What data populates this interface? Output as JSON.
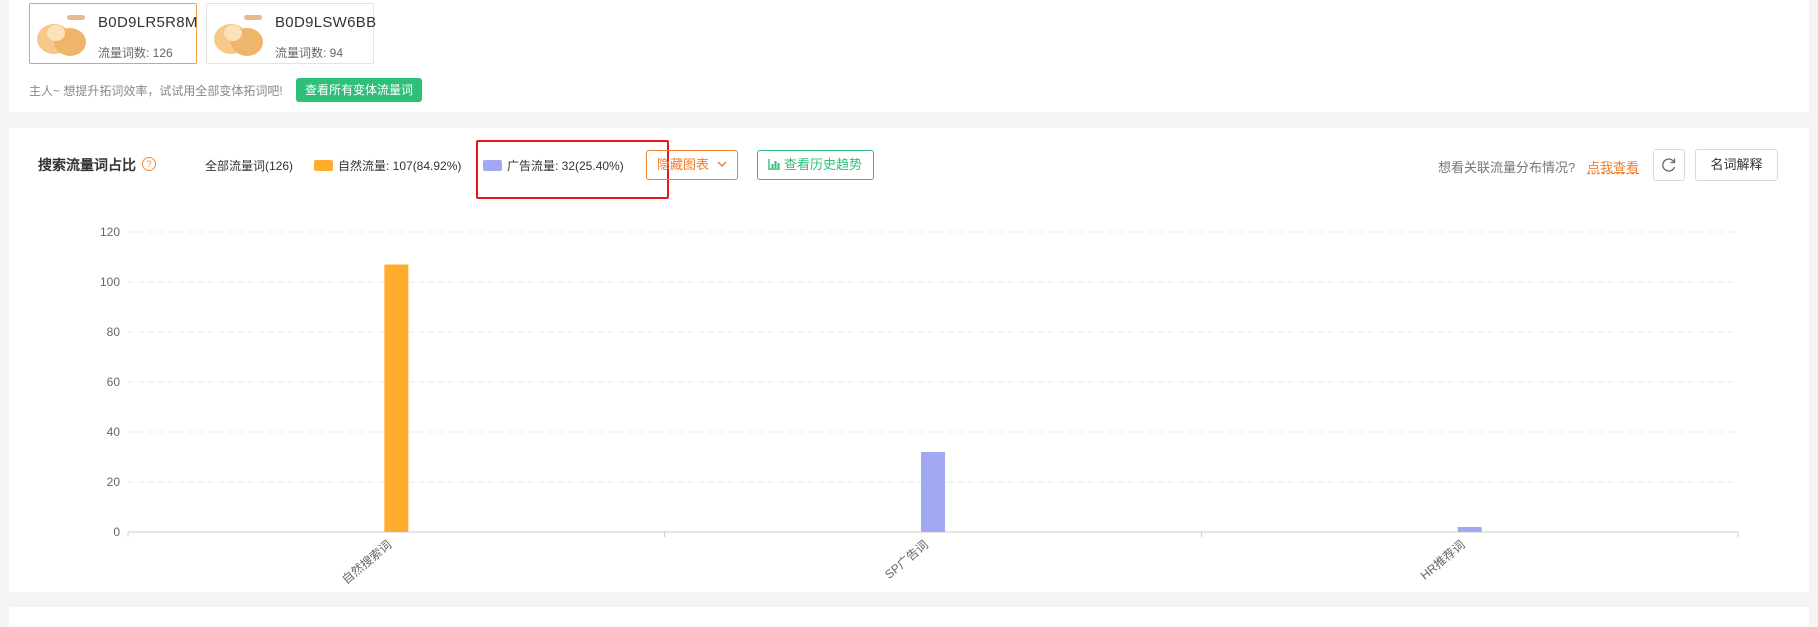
{
  "variants": [
    {
      "asin": "B0D9LR5R8M",
      "count_label": "流量词数: 126",
      "active": true
    },
    {
      "asin": "B0D9LSW6BB",
      "count_label": "流量词数: 94",
      "active": false
    }
  ],
  "tip": {
    "text": "主人~ 想提升拓词效率，试试用全部变体拓词吧!",
    "button_label": "查看所有变体流量词"
  },
  "chart_header": {
    "title": "搜索流量词占比",
    "help_icon": "question-circle-icon",
    "legend": {
      "all": "全部流量词(126)",
      "natural": "自然流量: 107(84.92%)",
      "ad": "广告流量: 32(25.40%)"
    },
    "hide_chart_label": "隐藏图表",
    "history_trend_label": "查看历史趋势",
    "related_question": "想看关联流量分布情况?",
    "related_link": "点我查看",
    "term_explain_label": "名词解释"
  },
  "colors": {
    "natural": "#ffad2f",
    "ad": "#a1a9f1",
    "accent_orange": "#f07e2c",
    "accent_green": "#2ec07a",
    "highlight": "#e8161c"
  },
  "chart_data": {
    "type": "bar",
    "categories": [
      "自然搜索词",
      "SP广告词",
      "HR推荐词"
    ],
    "values": [
      107,
      32,
      2
    ],
    "bar_colors": [
      "#ffad2f",
      "#a1a9f1",
      "#a1a9f1"
    ],
    "ylim": [
      0,
      120
    ],
    "yticks": [
      0,
      20,
      40,
      60,
      80,
      100,
      120
    ],
    "grid": true
  }
}
